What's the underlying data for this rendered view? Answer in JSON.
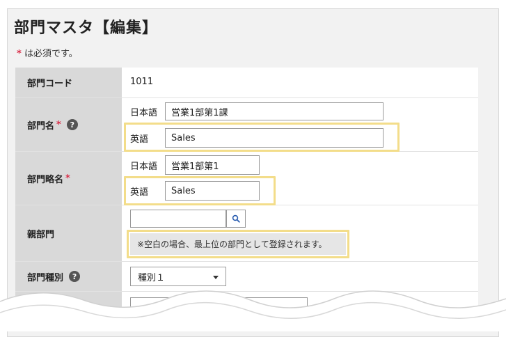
{
  "page": {
    "title": "部門マスタ【編集】",
    "required_star": "*",
    "required_note": "は必須です。"
  },
  "form": {
    "dept_code": {
      "label": "部門コード",
      "value": "1011"
    },
    "dept_name": {
      "label": "部門名",
      "star": "*",
      "help": "?",
      "ja_label": "日本語",
      "ja_value": "営業1部第1課",
      "en_label": "英語",
      "en_value": "Sales"
    },
    "dept_short_name": {
      "label": "部門略名",
      "star": "*",
      "ja_label": "日本語",
      "ja_value": "営業1部第1",
      "en_label": "英語",
      "en_value": "Sales"
    },
    "parent_dept": {
      "label": "親部門",
      "value": "",
      "note": "※空白の場合、最上位の部門として登録されます。"
    },
    "dept_type": {
      "label": "部門種別",
      "help": "?",
      "selected": "種別１"
    }
  },
  "icons": {
    "search": "search-icon",
    "help": "help-icon",
    "caret": "chevron-down-icon"
  },
  "colors": {
    "highlight": "#f3dd8a",
    "required": "#d9304a",
    "search_icon": "#2a5db0"
  }
}
